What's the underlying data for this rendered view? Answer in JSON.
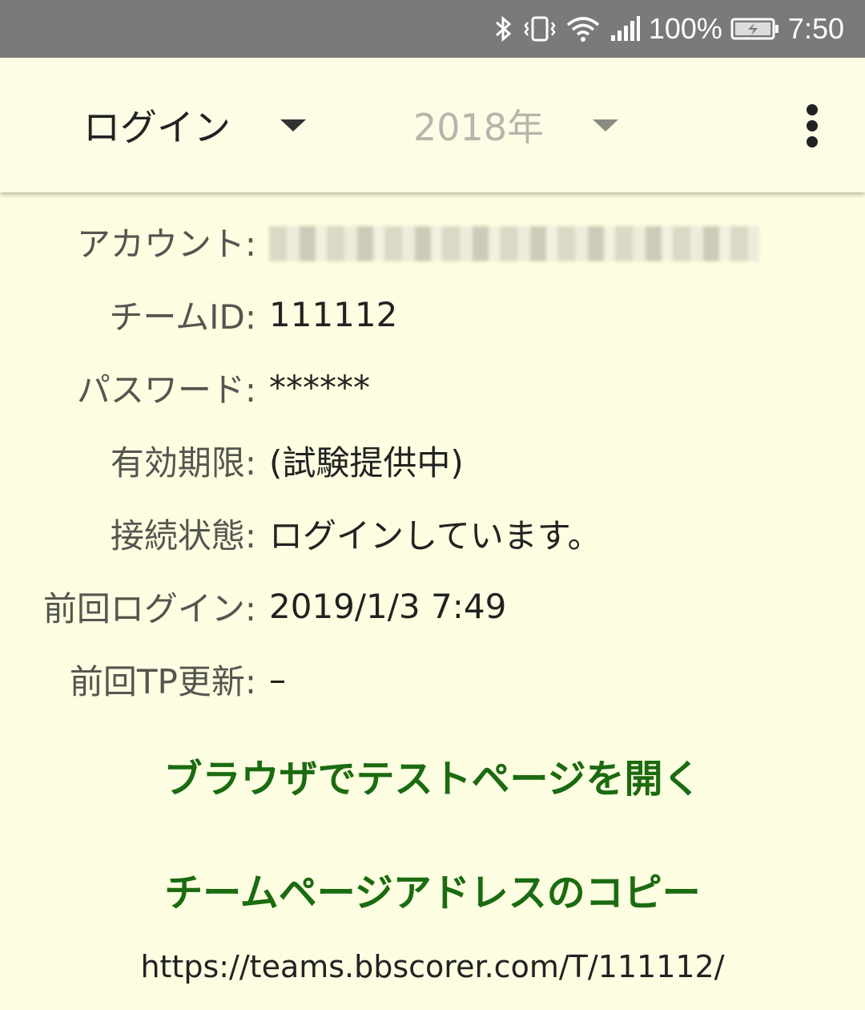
{
  "status_bar": {
    "battery_percent": "100%",
    "time": "7:50",
    "icons": [
      "bluetooth-icon",
      "vibrate-icon",
      "wifi-icon",
      "cell-signal-icon",
      "battery-charging-icon"
    ]
  },
  "toolbar": {
    "mode_label": "ログイン",
    "year_label": "2018年",
    "overflow_icon": "more-vert-icon"
  },
  "info": {
    "account": {
      "label": "アカウント:",
      "value": ""
    },
    "team_id": {
      "label": "チームID:",
      "value": "111112"
    },
    "password": {
      "label": "パスワード:",
      "value": "******"
    },
    "expiry": {
      "label": "有効期限:",
      "value": "(試験提供中)"
    },
    "connection": {
      "label": "接続状態:",
      "value": "ログインしています。"
    },
    "last_login": {
      "label": "前回ログイン:",
      "value": "2019/1/3 7:49"
    },
    "last_tp_update": {
      "label": "前回TP更新:",
      "value": "–"
    }
  },
  "actions": {
    "open_test_page": "ブラウザでテストページを開く",
    "copy_team_page": "チームページアドレスのコピー"
  },
  "team_url": "https://teams.bbscorer.com/T/111112/",
  "colors": {
    "background": "#fdfde1",
    "status_bar": "#7a7a7a",
    "action_green": "#1b6b10"
  }
}
